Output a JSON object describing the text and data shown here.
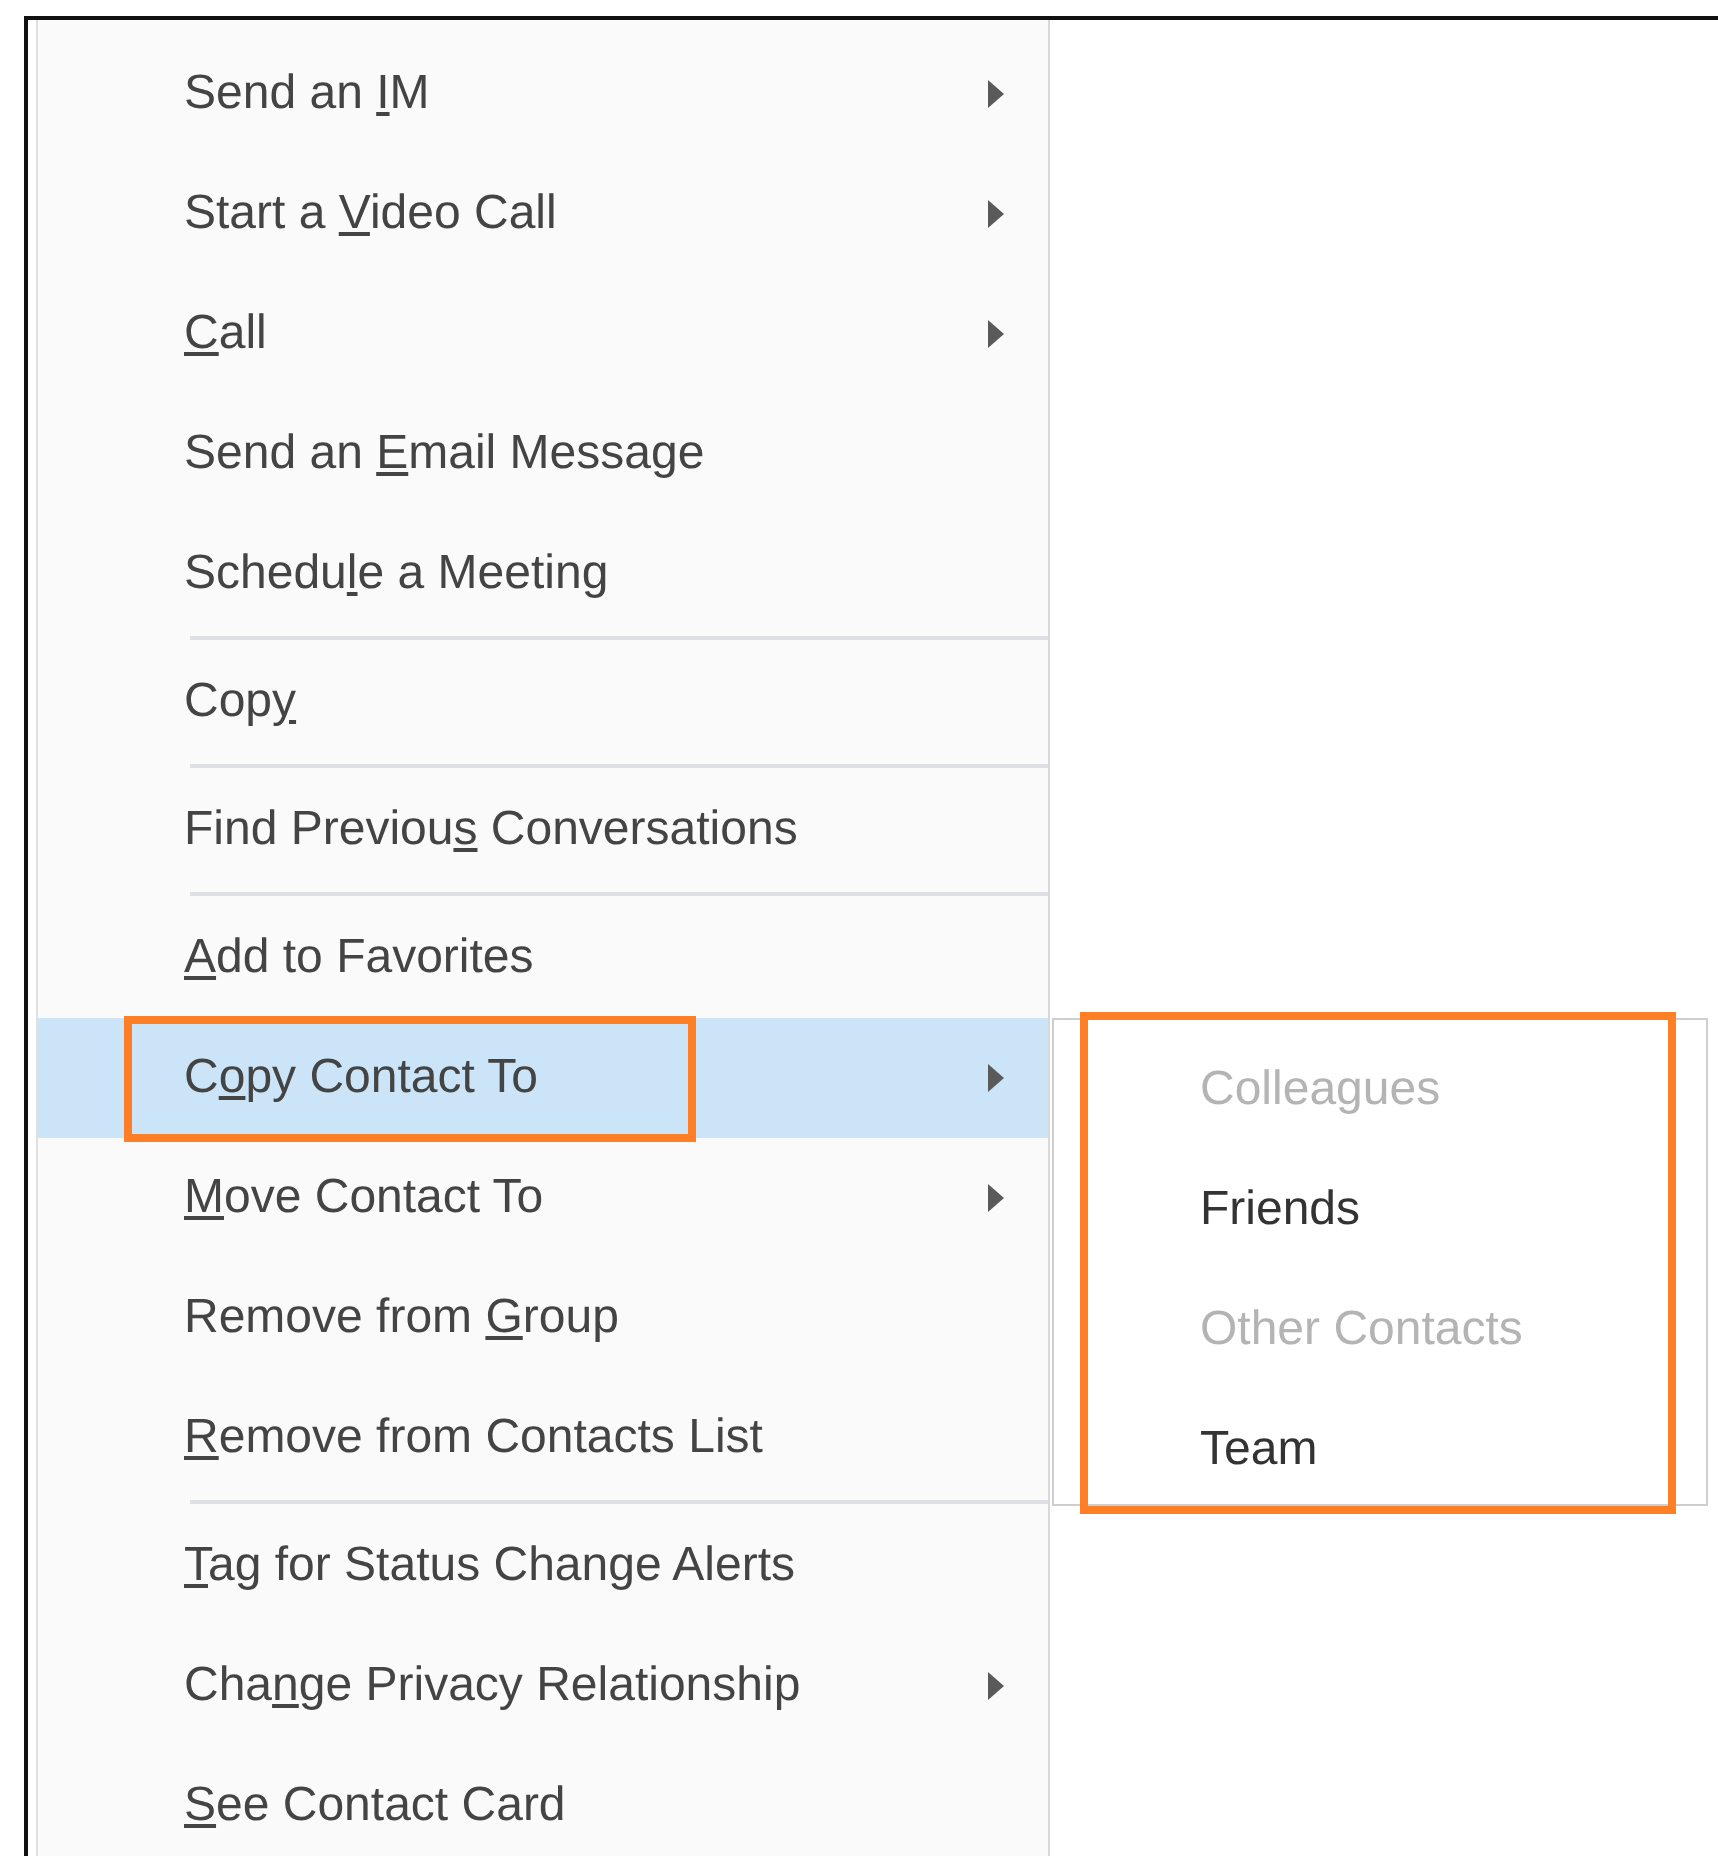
{
  "menu": {
    "items": [
      {
        "kind": "item",
        "before": "Send an ",
        "key": "I",
        "after": "M",
        "submenu": true,
        "selected": false,
        "callout": false
      },
      {
        "kind": "item",
        "before": "Start a ",
        "key": "V",
        "after": "ideo Call",
        "submenu": true,
        "selected": false,
        "callout": false
      },
      {
        "kind": "item",
        "key": "C",
        "after": "all",
        "submenu": true,
        "selected": false,
        "callout": false
      },
      {
        "kind": "item",
        "before": "Send an ",
        "key": "E",
        "after": "mail Message",
        "submenu": false,
        "selected": false,
        "callout": false
      },
      {
        "kind": "item",
        "before": "Schedu",
        "key": "l",
        "after": "e a Meeting",
        "submenu": false,
        "selected": false,
        "callout": false
      },
      {
        "kind": "separator"
      },
      {
        "kind": "item",
        "before": "Cop",
        "key": "y",
        "submenu": false,
        "selected": false,
        "callout": false
      },
      {
        "kind": "separator"
      },
      {
        "kind": "item",
        "before": "Find Previou",
        "key": "s",
        "after": " Conversations",
        "submenu": false,
        "selected": false,
        "callout": false
      },
      {
        "kind": "separator"
      },
      {
        "kind": "item",
        "key": "A",
        "after": "dd to Favorites",
        "submenu": false,
        "selected": false,
        "callout": false
      },
      {
        "kind": "item",
        "before": "C",
        "key": "o",
        "after": "py Contact To",
        "submenu": true,
        "selected": true,
        "callout": true
      },
      {
        "kind": "item",
        "key": "M",
        "after": "ove Contact To",
        "submenu": true,
        "selected": false,
        "callout": false
      },
      {
        "kind": "item",
        "before": "Remove from ",
        "key": "G",
        "after": "roup",
        "submenu": false,
        "selected": false,
        "callout": false
      },
      {
        "kind": "item",
        "key": "R",
        "after": "emove from Contacts List",
        "submenu": false,
        "selected": false,
        "callout": false
      },
      {
        "kind": "separator"
      },
      {
        "kind": "item",
        "key": "T",
        "after": "ag for Status Change Alerts",
        "submenu": false,
        "selected": false,
        "callout": false
      },
      {
        "kind": "item",
        "before": "Cha",
        "key": "n",
        "after": "ge Privacy Relationship",
        "submenu": true,
        "selected": false,
        "callout": false
      },
      {
        "kind": "item",
        "key": "S",
        "after": "ee Contact Card",
        "submenu": false,
        "selected": false,
        "callout": false
      }
    ]
  },
  "submenu": {
    "callout": true,
    "items": [
      {
        "label": "Colleagues",
        "disabled": true
      },
      {
        "label": "Friends",
        "disabled": false
      },
      {
        "label": "Other Contacts",
        "disabled": true
      },
      {
        "label": "Team",
        "disabled": false
      }
    ]
  }
}
